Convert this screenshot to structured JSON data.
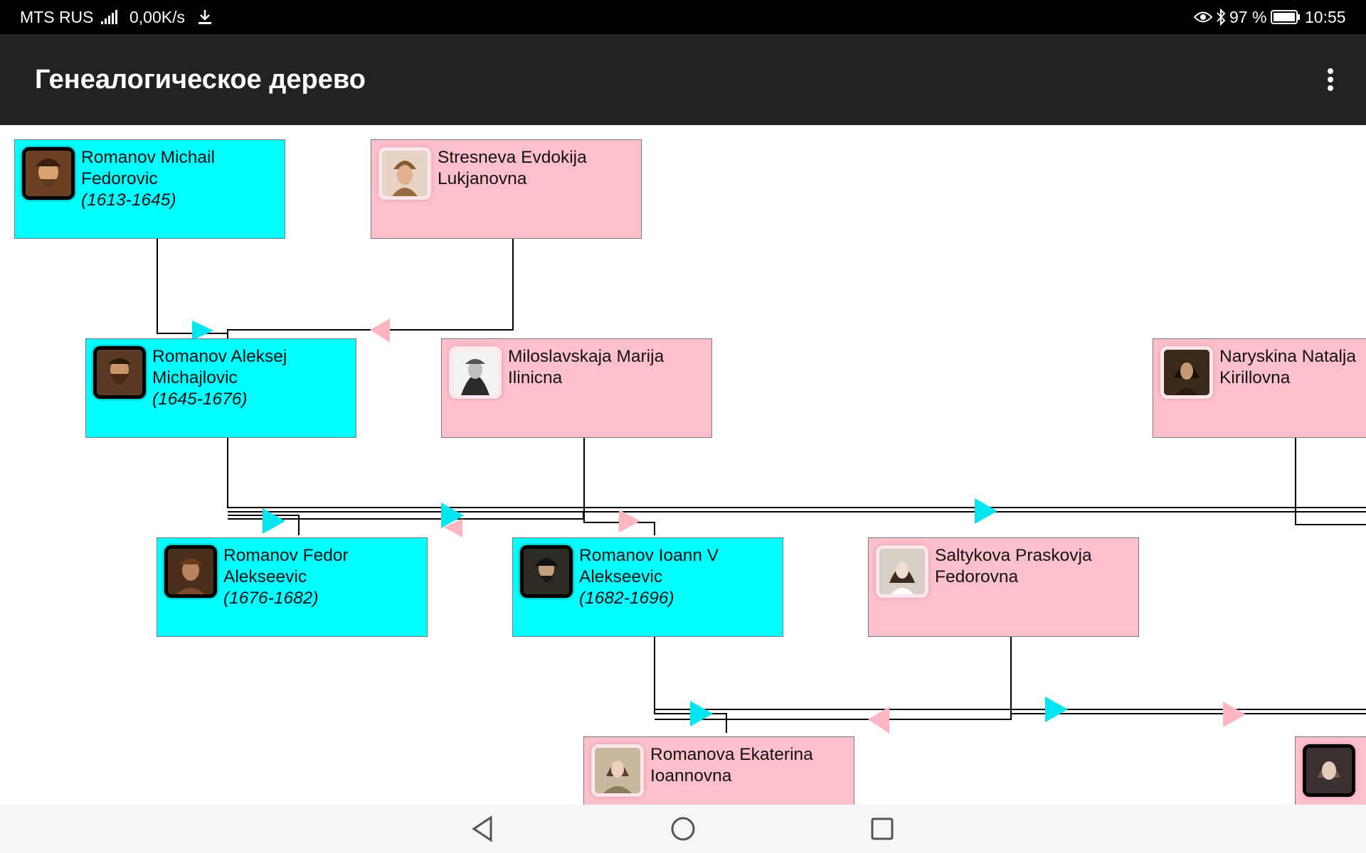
{
  "status_bar": {
    "carrier": "MTS RUS",
    "net_speed": "0,00K/s",
    "battery": "97 %",
    "time": "10:55",
    "icons": [
      "signal-icon",
      "download-icon",
      "eye-icon",
      "bluetooth-icon",
      "battery-icon"
    ]
  },
  "app_bar": {
    "title": "Генеалогическое дерево",
    "menu_icon": "more-vert-icon"
  },
  "colors": {
    "male": "#00ffff",
    "female": "#ffc0cb",
    "status_bar": "#000000",
    "app_bar": "#222222",
    "nav_bar": "#f6f6f6"
  },
  "persons": [
    {
      "id": "p1",
      "gender": "male",
      "name_line1": "Romanov Michail",
      "name_line2": "Fedorovic",
      "years": "(1613-1645)"
    },
    {
      "id": "p2",
      "gender": "female",
      "name_line1": "Stresneva Evdokija",
      "name_line2": "Lukjanovna",
      "years": ""
    },
    {
      "id": "p3",
      "gender": "male",
      "name_line1": "Romanov Aleksej",
      "name_line2": "Michajlovic",
      "years": "(1645-1676)"
    },
    {
      "id": "p4",
      "gender": "female",
      "name_line1": "Miloslavskaja Marija",
      "name_line2": "Ilinicna",
      "years": ""
    },
    {
      "id": "p5",
      "gender": "female",
      "name_line1": "Naryskina Natalja",
      "name_line2": "Kirillovna",
      "years": ""
    },
    {
      "id": "p6",
      "gender": "male",
      "name_line1": "Romanov Fedor",
      "name_line2": "Alekseevic",
      "years": "(1676-1682)"
    },
    {
      "id": "p7",
      "gender": "male",
      "name_line1": "Romanov Ioann V",
      "name_line2": "Alekseevic",
      "years": "(1682-1696)"
    },
    {
      "id": "p8",
      "gender": "female",
      "name_line1": "Saltykova Praskovja",
      "name_line2": "Fedorovna",
      "years": ""
    },
    {
      "id": "p9",
      "gender": "female",
      "name_line1": "Romanova Ekaterina",
      "name_line2": "Ioannovna",
      "years": ""
    },
    {
      "id": "p10",
      "gender": "female",
      "name_line1": "",
      "name_line2": "",
      "years": ""
    }
  ],
  "nav_bar": {
    "icons": [
      "back-icon",
      "home-icon",
      "recents-icon"
    ]
  }
}
